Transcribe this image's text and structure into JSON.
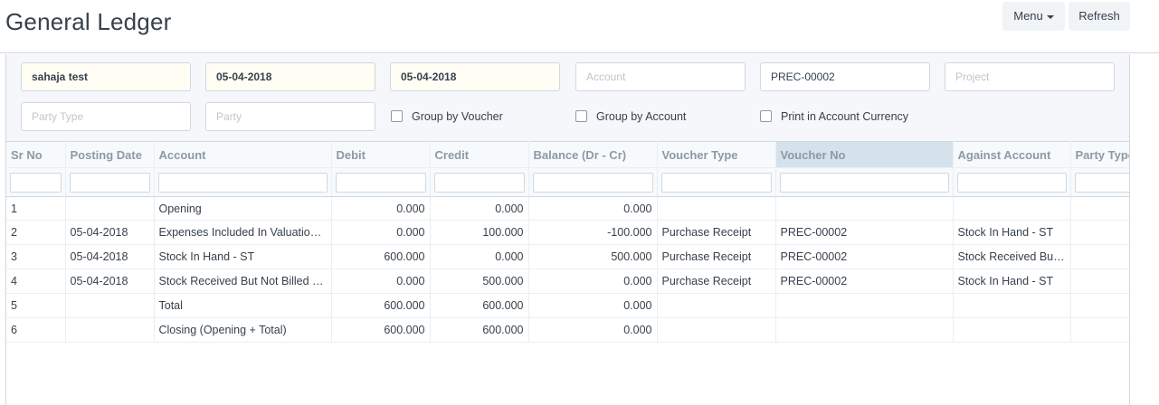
{
  "header": {
    "title": "General Ledger",
    "menu_label": "Menu",
    "refresh_label": "Refresh"
  },
  "filters": {
    "company": {
      "value": "sahaja test",
      "placeholder": ""
    },
    "from_date": {
      "value": "05-04-2018",
      "placeholder": ""
    },
    "to_date": {
      "value": "05-04-2018",
      "placeholder": ""
    },
    "account": {
      "value": "",
      "placeholder": "Account"
    },
    "voucher_no": {
      "value": "PREC-00002",
      "placeholder": ""
    },
    "project": {
      "value": "",
      "placeholder": "Project"
    },
    "party_type": {
      "value": "",
      "placeholder": "Party Type"
    },
    "party": {
      "value": "",
      "placeholder": "Party"
    },
    "group_by_voucher": "Group by Voucher",
    "group_by_account": "Group by Account",
    "print_in_account_currency": "Print in Account Currency"
  },
  "table": {
    "columns": [
      "Sr No",
      "Posting Date",
      "Account",
      "Debit",
      "Credit",
      "Balance (Dr - Cr)",
      "Voucher Type",
      "Voucher No",
      "Against Account",
      "Party Type"
    ],
    "rows": [
      [
        "1",
        "",
        "Opening",
        "0.000",
        "0.000",
        "0.000",
        "",
        "",
        "",
        ""
      ],
      [
        "2",
        "05-04-2018",
        "Expenses Included In Valuation - ST",
        "0.000",
        "100.000",
        "-100.000",
        "Purchase Receipt",
        "PREC-00002",
        "Stock In Hand - ST",
        ""
      ],
      [
        "3",
        "05-04-2018",
        "Stock In Hand - ST",
        "600.000",
        "0.000",
        "500.000",
        "Purchase Receipt",
        "PREC-00002",
        "Stock Received But Not Billed - ST",
        ""
      ],
      [
        "4",
        "05-04-2018",
        "Stock Received But Not Billed - ST",
        "0.000",
        "500.000",
        "0.000",
        "Purchase Receipt",
        "PREC-00002",
        "Stock In Hand - ST",
        ""
      ],
      [
        "5",
        "",
        "Total",
        "600.000",
        "600.000",
        "0.000",
        "",
        "",
        "",
        ""
      ],
      [
        "6",
        "",
        "Closing (Opening + Total)",
        "600.000",
        "600.000",
        "0.000",
        "",
        "",
        "",
        ""
      ]
    ]
  },
  "colors": {
    "active_header": "#d5e2eb",
    "highlight_field": "#fffdf4"
  }
}
